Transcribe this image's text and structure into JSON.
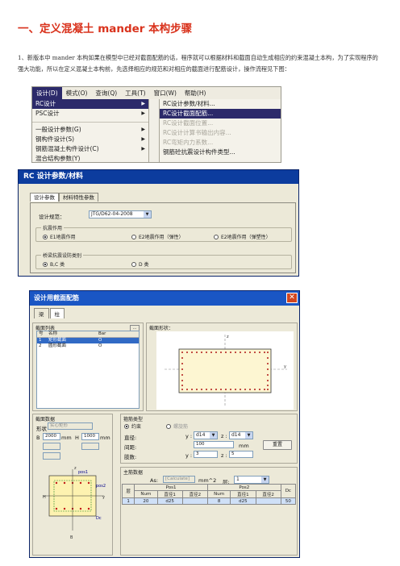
{
  "doc": {
    "title": "一、定义混凝土 mander 本构步骤",
    "paragraph": "1、新版本中 mander 本构如果在模型中已经对截面配筋的话，程序就可以根据材料和截面自动生成相应的约束混凝土本构，为了实现程序的强大功能，所以在定义混凝土本构前，先选择相应的规范和对相应的截面进行配筋设计，操作流程见下图："
  },
  "menu": {
    "bar": [
      "设计(D)",
      "模式(O)",
      "查询(Q)",
      "工具(T)",
      "窗口(W)",
      "帮助(H)"
    ],
    "level1": [
      "RC设计",
      "PSC设计",
      "一般设计参数(G)",
      "钢构件设计(S)",
      "钢筋混凝土构件设计(C)",
      "混合结构参数(Y)"
    ],
    "level2": [
      "RC设计参数/材料...",
      "RC设计截面配筋...",
      "RC设计截面位置...",
      "RC设计计算书输出内容...",
      "RC弯矩内力系数...",
      "钢筋砼抗震设计构件类型..."
    ]
  },
  "dialog1": {
    "title": "RC 设计参数/材料",
    "tabs": [
      "设计参数",
      "材料特性参数"
    ],
    "code_label": "设计规范：",
    "code_value": "JTG/D62-04-2008",
    "group1_title": "抗震作用",
    "radios1": [
      "E1地震作用",
      "E2地震作用（弹性）",
      "E2地震作用（弹塑性）"
    ],
    "group2_title": "桥梁抗震设防类别",
    "radios2": [
      "B,C 类",
      "D 类"
    ]
  },
  "dialog2": {
    "title": "设计用截面配筋",
    "tabs": [
      "梁",
      "柱"
    ],
    "section_list_title": "截面列表",
    "list_headers": [
      "号",
      "名称",
      "Bar"
    ],
    "list_rows": [
      {
        "no": "1",
        "name": "矩形截面",
        "bar": "O"
      },
      {
        "no": "2",
        "name": "圆形截面",
        "bar": "O"
      }
    ],
    "shape_title": "截面形状：",
    "section_data_title": "截面数据",
    "shape_label": "形状",
    "shape_value": "实心矩形",
    "b_label": "B",
    "b_value": "2000",
    "h_label": "H",
    "h_value": "1000",
    "unit": "mm",
    "tie_title": "箍筋类型",
    "tie_options": [
      "约束",
      "螺旋筋"
    ],
    "dia_label": "直径:",
    "dia_y": "d14",
    "dia_z": "d14",
    "spacing_label": "间距:",
    "spacing_value": "100",
    "spacing_unit": "mm",
    "legs_label": "肢数:",
    "legs_y": "3",
    "legs_z": "5",
    "clear_button": "重置",
    "main_title": "主筋数据",
    "as_label": "As:",
    "as_value": "[Calculate]",
    "as_unit": "mm^2",
    "layer_label": "层:",
    "layer_value": "1",
    "table_headers": [
      "层",
      "Pos1",
      "Pos2",
      "Dc"
    ],
    "table_sub": [
      "Num",
      "直径1",
      "直径2",
      "Num",
      "直径1",
      "直径2"
    ],
    "table_row": [
      "1",
      "20",
      "d25",
      "",
      "",
      "8",
      "d25",
      "",
      "",
      "50"
    ],
    "diagram_labels": [
      "pos1",
      "pos2",
      "H",
      "B",
      "Dc",
      "y",
      "z"
    ]
  }
}
